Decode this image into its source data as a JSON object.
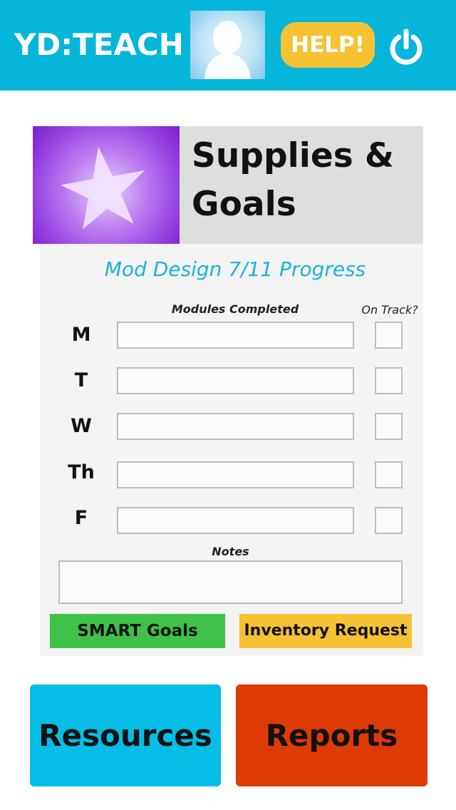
{
  "header": {
    "app_name": "YD:TEACH",
    "avatar_icon": "user-silhouette-icon",
    "help_label": "HELP!",
    "power_icon": "power-icon",
    "background_color": "#05b5da"
  },
  "banner": {
    "image_icon": "star-icon",
    "title": "Supplies & Goals"
  },
  "panel": {
    "title": "Mod Design 7/11 Progress",
    "modules_header": "Modules Completed",
    "on_track_header": "On Track?",
    "days": [
      {
        "label": "M",
        "modules_value": "",
        "on_track": false
      },
      {
        "label": "T",
        "modules_value": "",
        "on_track": false
      },
      {
        "label": "W",
        "modules_value": "",
        "on_track": false
      },
      {
        "label": "Th",
        "modules_value": "",
        "on_track": false
      },
      {
        "label": "F",
        "modules_value": "",
        "on_track": false
      }
    ],
    "notes_label": "Notes",
    "notes_value": "",
    "smart_goals_label": "SMART Goals",
    "inventory_request_label": "Inventory Request"
  },
  "footer": {
    "resources_label": "Resources",
    "reports_label": "Reports"
  },
  "colors": {
    "accent_blue": "#05b5da",
    "help_yellow": "#f4c233",
    "smart_green": "#3fc14a",
    "reports_red": "#dd3a05"
  }
}
